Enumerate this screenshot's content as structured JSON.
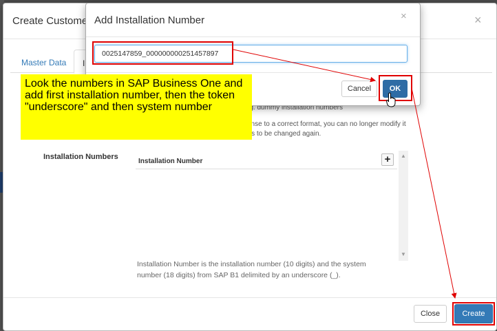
{
  "main_modal": {
    "title": "Create Customer",
    "close_glyph": "×",
    "tabs": [
      {
        "label": "Master Data",
        "active": false
      },
      {
        "label": "In",
        "active": true
      }
    ],
    "help_text": [
      "e.g. dummy installation numbers",
      "cense to a correct format, you can no longer modify it",
      "has to be changed again."
    ],
    "installation_numbers": {
      "label": "Installation Numbers",
      "column_header": "Installation Number",
      "add_button": "+"
    },
    "footnote": [
      "Installation Number is the installation number (10 digits) and the system",
      "number (18 digits) from SAP B1 delimited by an underscore (_)."
    ],
    "buttons": {
      "close": "Close",
      "create": "Create"
    }
  },
  "add_modal": {
    "title": "Add Installation Number",
    "close_glyph": "×",
    "input_value": "0025147859_000000000251457897",
    "buttons": {
      "cancel": "Cancel",
      "ok": "OK"
    }
  },
  "callout": {
    "text": "Look the numbers in SAP Business One and add first installation number, then the token \"underscore\" and then system number"
  },
  "colors": {
    "primary": "#337ab7",
    "annotation_red": "#e00000",
    "callout_yellow": "#ffff00"
  },
  "icons": [
    "close-icon",
    "plus-icon",
    "scroll-up-icon",
    "scroll-down-icon",
    "hand-cursor-icon"
  ]
}
